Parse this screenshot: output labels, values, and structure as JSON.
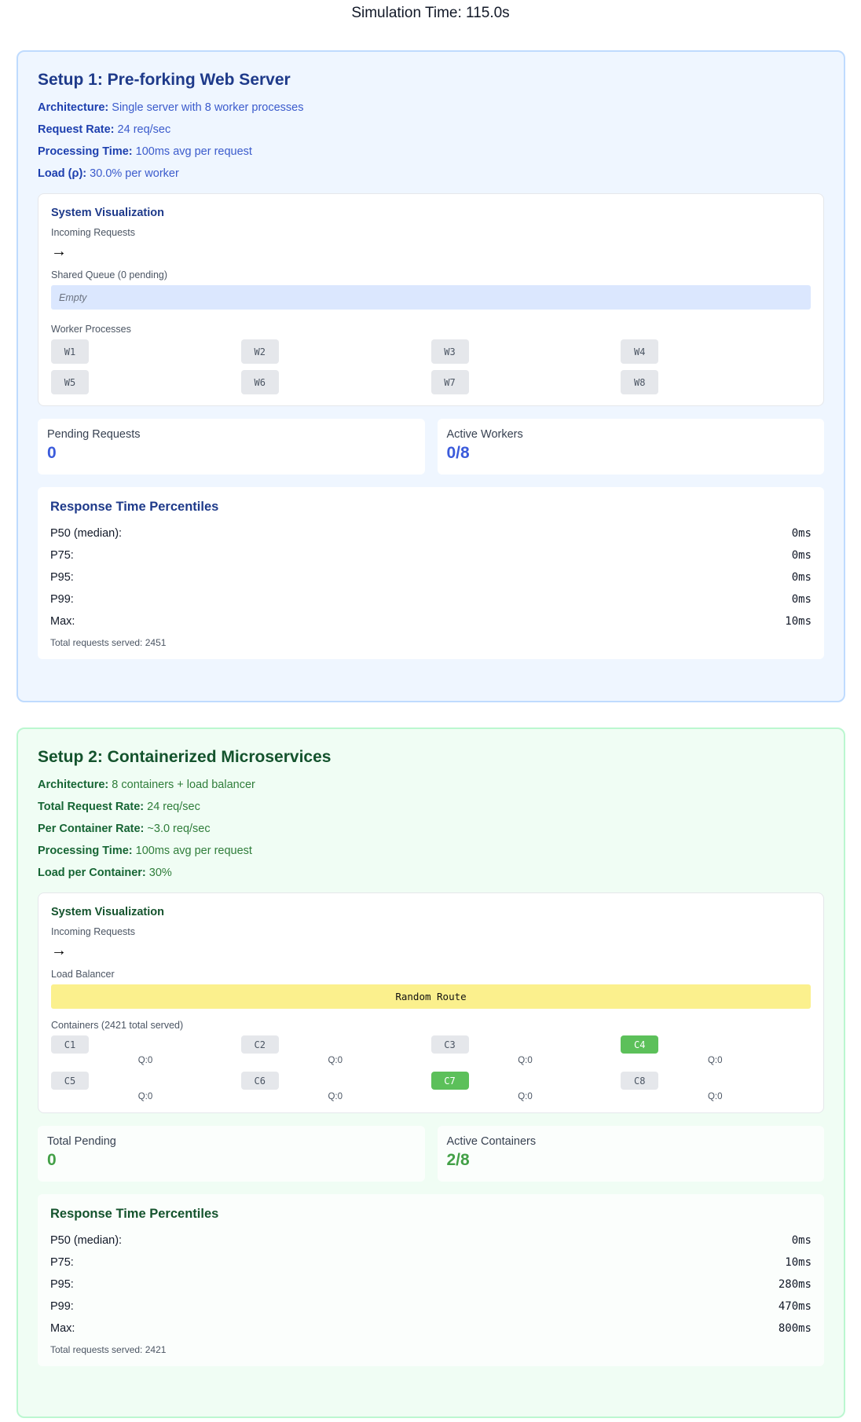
{
  "simulation_time": "Simulation Time: 115.0s",
  "setup1": {
    "title": "Setup 1: Pre-forking Web Server",
    "specs": [
      {
        "label": "Architecture:",
        "value": "Single server with 8 worker processes"
      },
      {
        "label": "Request Rate:",
        "value": "24 req/sec"
      },
      {
        "label": "Processing Time:",
        "value": "100ms avg per request"
      },
      {
        "label": "Load (ρ):",
        "value": "30.0% per worker"
      }
    ],
    "viz_title": "System Visualization",
    "incoming_label": "Incoming Requests",
    "arrow": "→",
    "queue_label": "Shared Queue (0 pending)",
    "queue_text": "Empty",
    "workers_label": "Worker Processes",
    "workers": [
      "W1",
      "W2",
      "W3",
      "W4",
      "W5",
      "W6",
      "W7",
      "W8"
    ],
    "stats": [
      {
        "label": "Pending Requests",
        "value": "0"
      },
      {
        "label": "Active Workers",
        "value": "0/8"
      }
    ],
    "percentiles_title": "Response Time Percentiles",
    "percentiles": [
      {
        "label": "P50 (median):",
        "value": "0ms"
      },
      {
        "label": "P75:",
        "value": "0ms"
      },
      {
        "label": "P95:",
        "value": "0ms"
      },
      {
        "label": "P99:",
        "value": "0ms"
      },
      {
        "label": "Max:",
        "value": "10ms"
      }
    ],
    "total_served": "Total requests served: 2451"
  },
  "setup2": {
    "title": "Setup 2: Containerized Microservices",
    "specs": [
      {
        "label": "Architecture:",
        "value": "8 containers + load balancer"
      },
      {
        "label": "Total Request Rate:",
        "value": "24 req/sec"
      },
      {
        "label": "Per Container Rate:",
        "value": "~3.0 req/sec"
      },
      {
        "label": "Processing Time:",
        "value": "100ms avg per request"
      },
      {
        "label": "Load per Container:",
        "value": "30%"
      }
    ],
    "viz_title": "System Visualization",
    "incoming_label": "Incoming Requests",
    "arrow": "→",
    "lb_label": "Load Balancer",
    "lb_text": "Random Route",
    "containers_label": "Containers (2421 total served)",
    "containers": [
      {
        "name": "C1",
        "queue": "Q:0",
        "active": false
      },
      {
        "name": "C2",
        "queue": "Q:0",
        "active": false
      },
      {
        "name": "C3",
        "queue": "Q:0",
        "active": false
      },
      {
        "name": "C4",
        "queue": "Q:0",
        "active": true
      },
      {
        "name": "C5",
        "queue": "Q:0",
        "active": false
      },
      {
        "name": "C6",
        "queue": "Q:0",
        "active": false
      },
      {
        "name": "C7",
        "queue": "Q:0",
        "active": true
      },
      {
        "name": "C8",
        "queue": "Q:0",
        "active": false
      }
    ],
    "stats": [
      {
        "label": "Total Pending",
        "value": "0"
      },
      {
        "label": "Active Containers",
        "value": "2/8"
      }
    ],
    "percentiles_title": "Response Time Percentiles",
    "percentiles": [
      {
        "label": "P50 (median):",
        "value": "0ms"
      },
      {
        "label": "P75:",
        "value": "10ms"
      },
      {
        "label": "P95:",
        "value": "280ms"
      },
      {
        "label": "P99:",
        "value": "470ms"
      },
      {
        "label": "Max:",
        "value": "800ms"
      }
    ],
    "total_served": "Total requests served: 2421"
  },
  "colors": {
    "active_container": "#5cc05a",
    "blue_accent": "#3b5bdb",
    "green_accent": "#43a047"
  }
}
